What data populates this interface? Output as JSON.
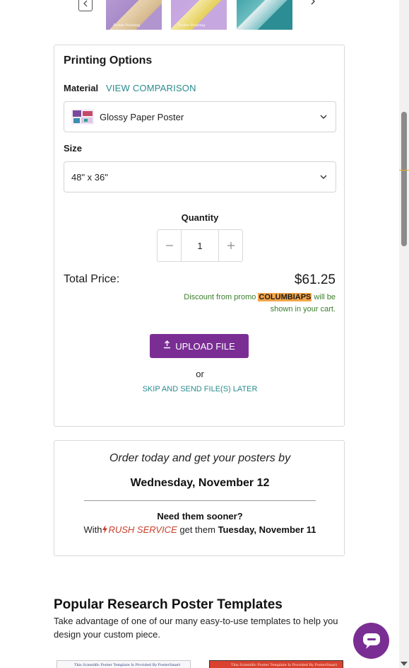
{
  "gallery": {
    "thumbnails": [
      {
        "caption": "Poster Printing"
      },
      {
        "caption": "Poster Printing"
      },
      {
        "caption": ""
      }
    ]
  },
  "printing_options": {
    "title": "Printing Options",
    "material_label": "Material",
    "view_comparison": "VIEW COMPARISON",
    "material_value": "Glossy Paper Poster",
    "size_label": "Size",
    "size_value": "48\" x 36\"",
    "quantity_label": "Quantity",
    "quantity_value": "1",
    "total_label": "Total Price:",
    "total_price": "$61.25",
    "promo_prefix": "Discount from promo ",
    "promo_code": "COLUMBIAPS",
    "promo_suffix": " will be shown in your cart.",
    "upload_label": "UPLOAD FILE",
    "or_text": "or",
    "skip_label": "SKIP AND SEND FILE(S) LATER"
  },
  "delivery": {
    "intro": "Order today and get your posters by",
    "date": "Wednesday, November 12",
    "sooner": "Need them sooner?",
    "with_text": "With",
    "rush_label": "RUSH SERVICE",
    "get_text": " get them ",
    "rush_date": "Tuesday, November 11"
  },
  "templates": {
    "title": "Popular Research Poster Templates",
    "description": "Take advantage of one of our many easy-to-use templates to help you design your custom piece.",
    "items": [
      {
        "caption": "This Scientific Poster Template Is Provided By PosterSmart"
      },
      {
        "caption": "This Scientific Poster Template Is Provided By PosterSmart"
      }
    ]
  },
  "colors": {
    "accent_purple": "#7a2e94",
    "link_teal": "#2a8b8e",
    "promo_green": "#3a7d2c",
    "promo_highlight": "#f5a64a",
    "rush_red": "#c8412b"
  }
}
